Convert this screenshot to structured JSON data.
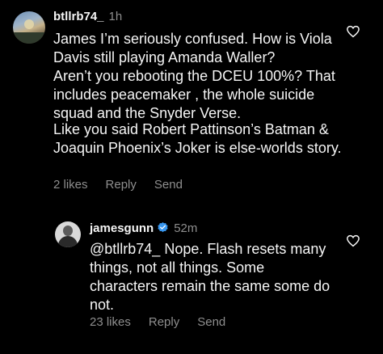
{
  "comments": [
    {
      "username": "btllrb74_",
      "time": "1h",
      "paragraphs": [
        "James I’m seriously confused.  How is Viola Davis still playing Amanda Waller?",
        "Aren’t you rebooting the DCEU 100%? That includes peacemaker , the whole suicide squad and the Snyder Verse.",
        "Like you said Robert Pattinson’s Batman & Joaquin Phoenix’s Joker is else-worlds story."
      ],
      "likes": "2 likes",
      "reply": "Reply",
      "send": "Send",
      "icons": {
        "like": "heart-outline-icon"
      }
    },
    {
      "username": "jamesgunn",
      "verified": true,
      "time": "52m",
      "text": "@btllrb74_ Nope. Flash resets many things, not all things. Some characters remain the same some do not.",
      "likes": "23 likes",
      "reply": "Reply",
      "send": "Send",
      "icons": {
        "verified": "verified-badge-icon",
        "like": "heart-outline-icon"
      }
    }
  ],
  "colors": {
    "background": "#000000",
    "text": "#f5f5f5",
    "secondary_text": "#8e8e8e",
    "verified_blue": "#3897f0"
  }
}
